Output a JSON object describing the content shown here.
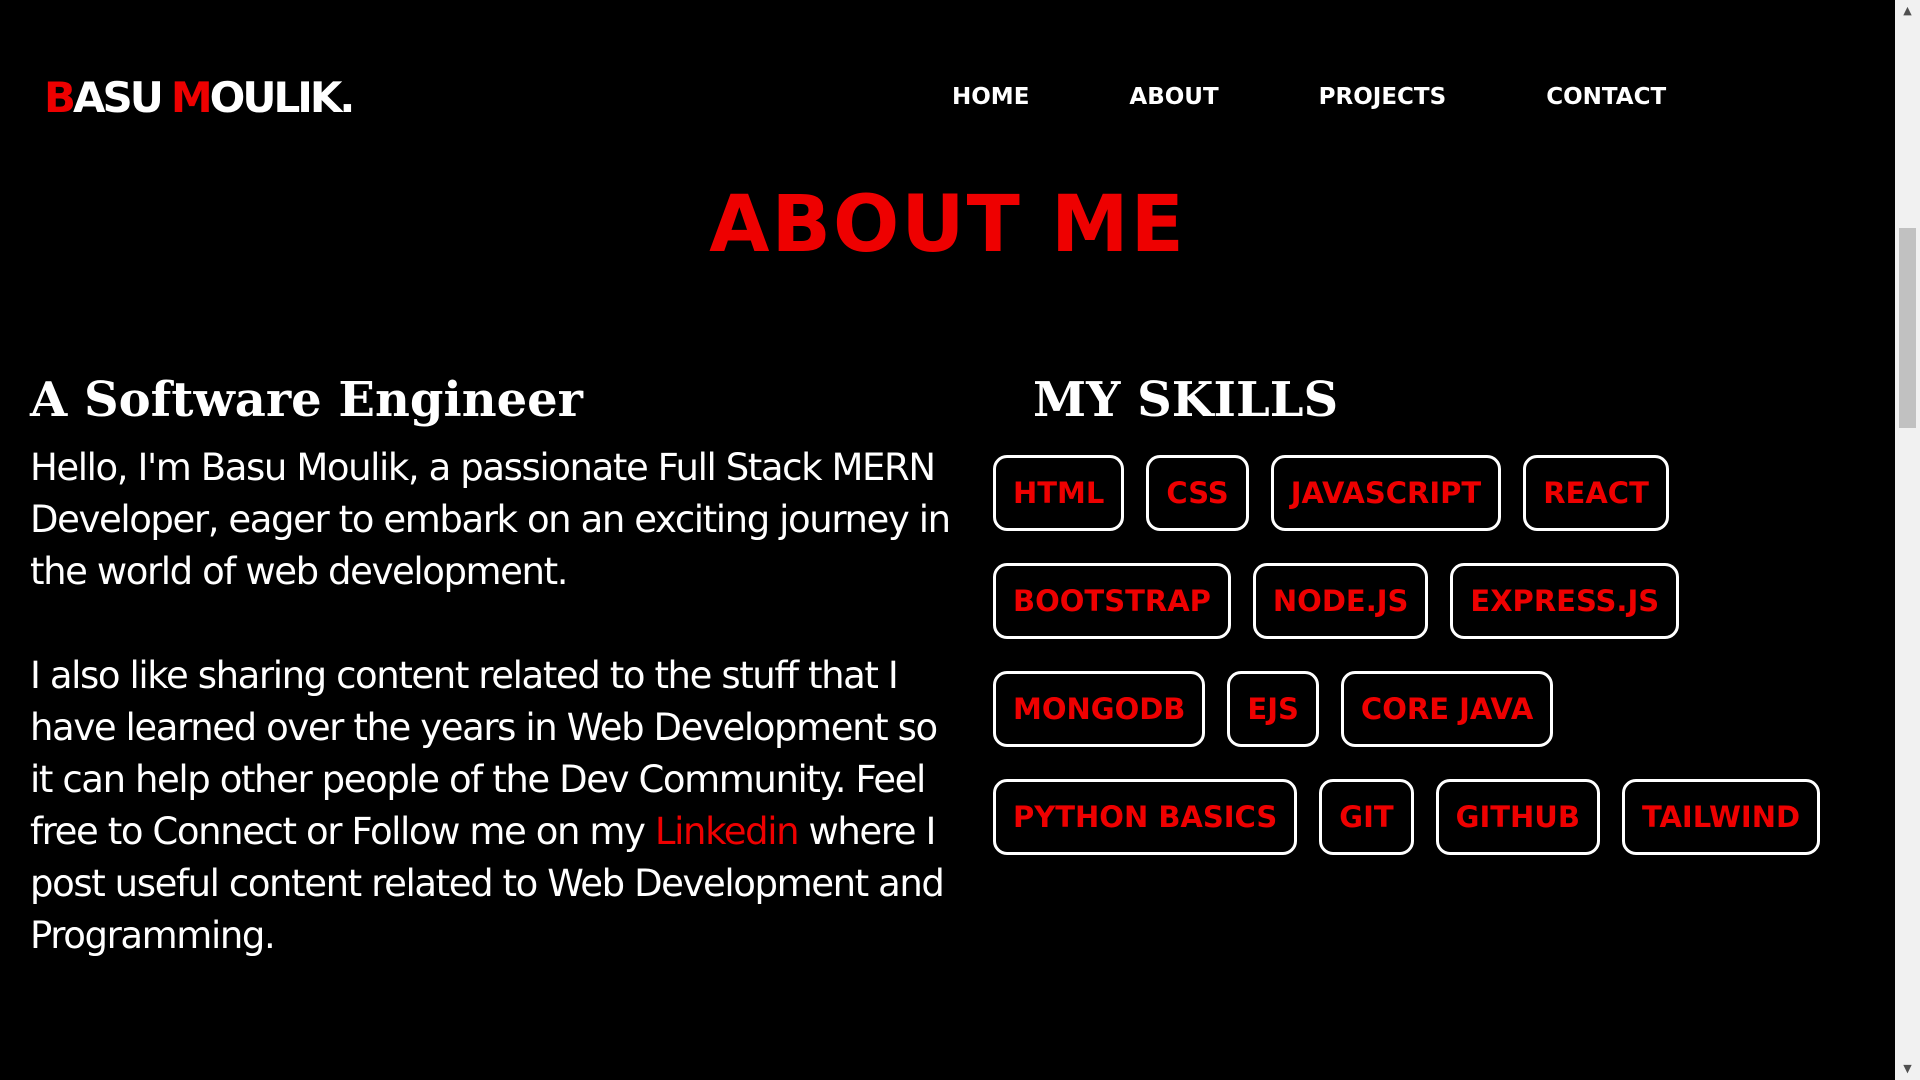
{
  "header": {
    "logo": {
      "first_initial": "B",
      "first_rest": "ASU",
      "last_initial": "M",
      "last_rest": "OULIK",
      "dot": "."
    },
    "nav": [
      {
        "label": "HOME"
      },
      {
        "label": "ABOUT"
      },
      {
        "label": "PROJECTS"
      },
      {
        "label": "CONTACT"
      }
    ]
  },
  "about": {
    "title": "ABOUT ME",
    "subtitle": "A Software Engineer",
    "paragraph1": "Hello, I'm Basu Moulik, a passionate Full Stack MERN Developer, eager to embark on an exciting journey in the world of web development.",
    "paragraph2_before": "I also like sharing content related to the stuff that I have learned over the years in Web Development so it can help other people of the Dev Community. Feel free to Connect or Follow me on my ",
    "paragraph2_link": "Linkedin",
    "paragraph2_after": " where I post useful content related to Web Development and Programming."
  },
  "skills": {
    "heading": "MY SKILLS",
    "items": [
      "HTML",
      "CSS",
      "JAVASCRIPT",
      "REACT",
      "BOOTSTRAP",
      "NODE.JS",
      "EXPRESS.JS",
      "MONGODB",
      "EJS",
      "CORE JAVA",
      "PYTHON BASICS",
      "GIT",
      "GITHUB",
      "TAILWIND"
    ]
  },
  "scrollbar": {
    "up_icon": "▲",
    "down_icon": "▼"
  },
  "colors": {
    "background": "#000000",
    "accent": "#ee0000",
    "text": "#ffffff"
  }
}
